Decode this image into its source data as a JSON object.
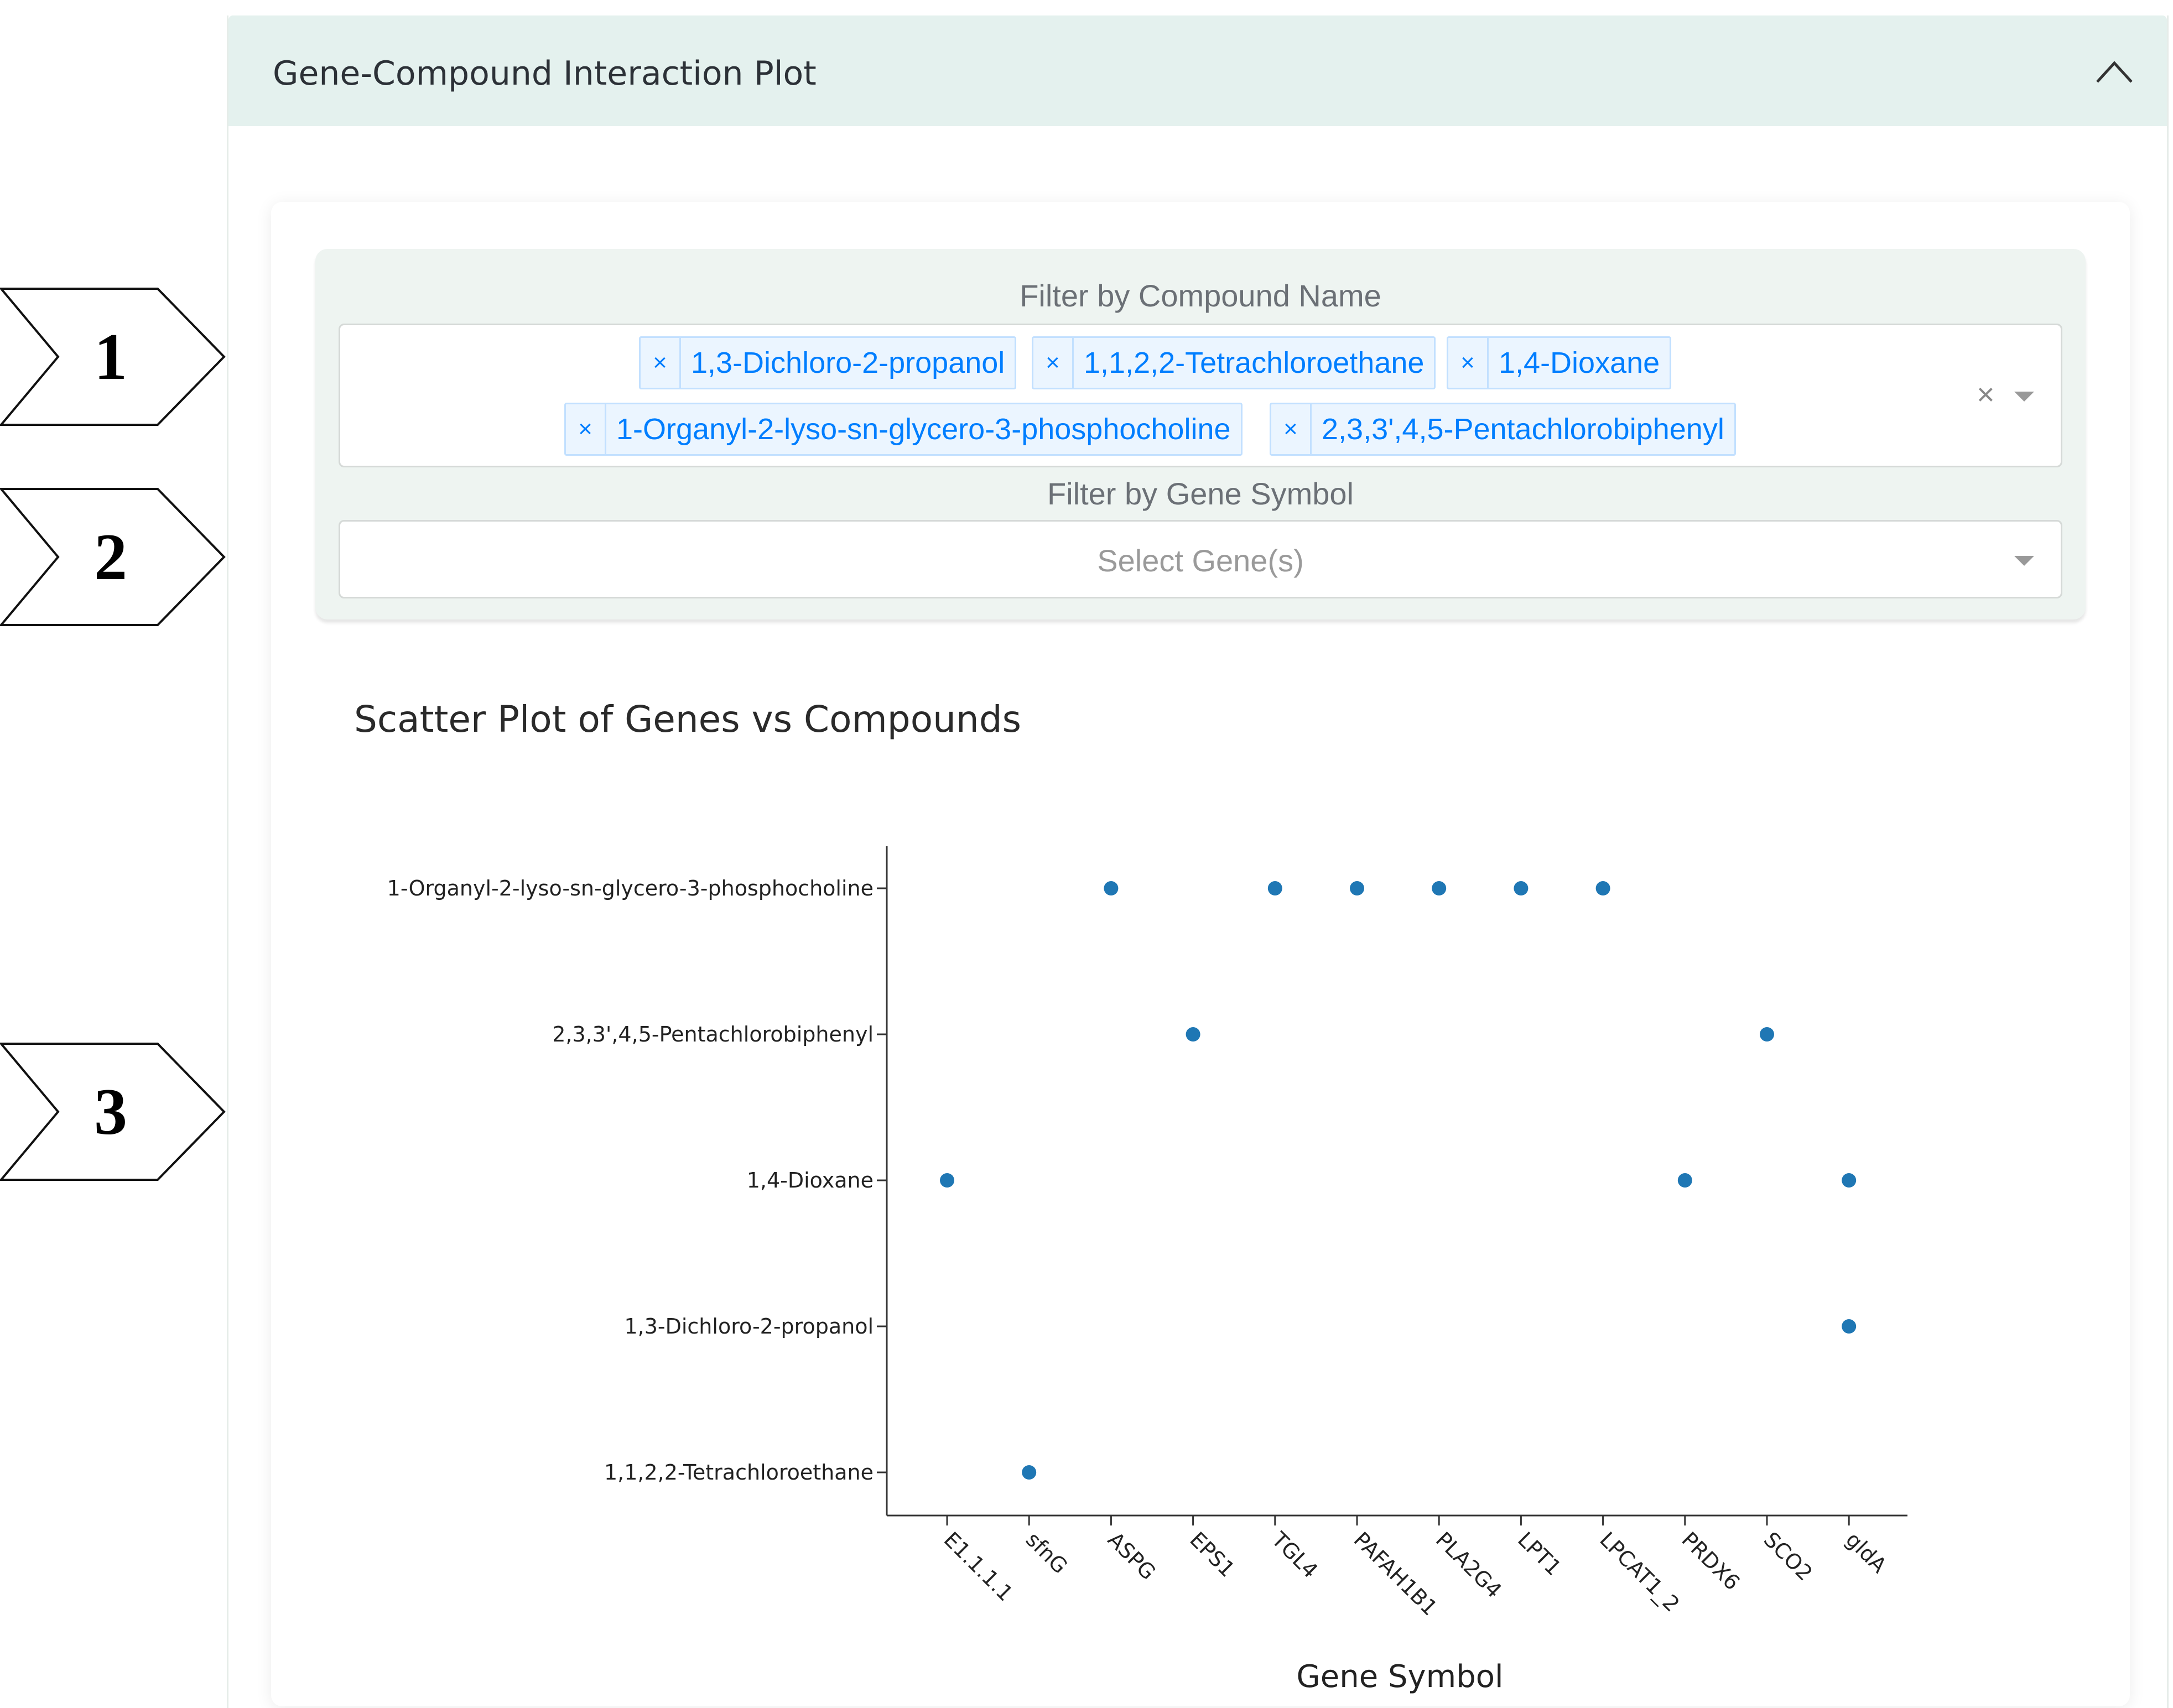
{
  "panel": {
    "title": "Gene-Compound Interaction Plot"
  },
  "filters": {
    "compound_label": "Filter by Compound Name",
    "compound_tags": [
      "1,3-Dichloro-2-propanol",
      "1,1,2,2-Tetrachloroethane",
      "1,4-Dioxane",
      "1-Organyl-2-lyso-sn-glycero-3-phosphocholine",
      "2,3,3',4,5-Pentachlorobiphenyl"
    ],
    "clear_symbol": "×",
    "remove_symbol": "×",
    "gene_label": "Filter by Gene Symbol",
    "gene_placeholder": "Select Gene(s)"
  },
  "markers": [
    "1",
    "2",
    "3"
  ],
  "chart_data": {
    "type": "scatter",
    "title": "Scatter Plot of Genes vs Compounds",
    "xlabel": "Gene Symbol",
    "ylabel": "",
    "x_categories": [
      "E1.1.1.1",
      "sfnG",
      "ASPG",
      "EPS1",
      "TGL4",
      "PAFAH1B1",
      "PLA2G4",
      "LPT1",
      "LPCAT1_2",
      "PRDX6",
      "SCO2",
      "gldA"
    ],
    "y_categories": [
      "1,1,2,2-Tetrachloroethane",
      "1,3-Dichloro-2-propanol",
      "1,4-Dioxane",
      "2,3,3',4,5-Pentachlorobiphenyl",
      "1-Organyl-2-lyso-sn-glycero-3-phosphocholine"
    ],
    "points": [
      {
        "x": "ASPG",
        "y": "1-Organyl-2-lyso-sn-glycero-3-phosphocholine"
      },
      {
        "x": "TGL4",
        "y": "1-Organyl-2-lyso-sn-glycero-3-phosphocholine"
      },
      {
        "x": "PAFAH1B1",
        "y": "1-Organyl-2-lyso-sn-glycero-3-phosphocholine"
      },
      {
        "x": "PLA2G4",
        "y": "1-Organyl-2-lyso-sn-glycero-3-phosphocholine"
      },
      {
        "x": "LPT1",
        "y": "1-Organyl-2-lyso-sn-glycero-3-phosphocholine"
      },
      {
        "x": "LPCAT1_2",
        "y": "1-Organyl-2-lyso-sn-glycero-3-phosphocholine"
      },
      {
        "x": "EPS1",
        "y": "2,3,3',4,5-Pentachlorobiphenyl"
      },
      {
        "x": "SCO2",
        "y": "2,3,3',4,5-Pentachlorobiphenyl"
      },
      {
        "x": "E1.1.1.1",
        "y": "1,4-Dioxane"
      },
      {
        "x": "PRDX6",
        "y": "1,4-Dioxane"
      },
      {
        "x": "gldA",
        "y": "1,4-Dioxane"
      },
      {
        "x": "gldA",
        "y": "1,3-Dichloro-2-propanol"
      },
      {
        "x": "sfnG",
        "y": "1,1,2,2-Tetrachloroethane"
      }
    ],
    "marker_color": "#1f77b4",
    "grid": false,
    "legend": "none"
  }
}
